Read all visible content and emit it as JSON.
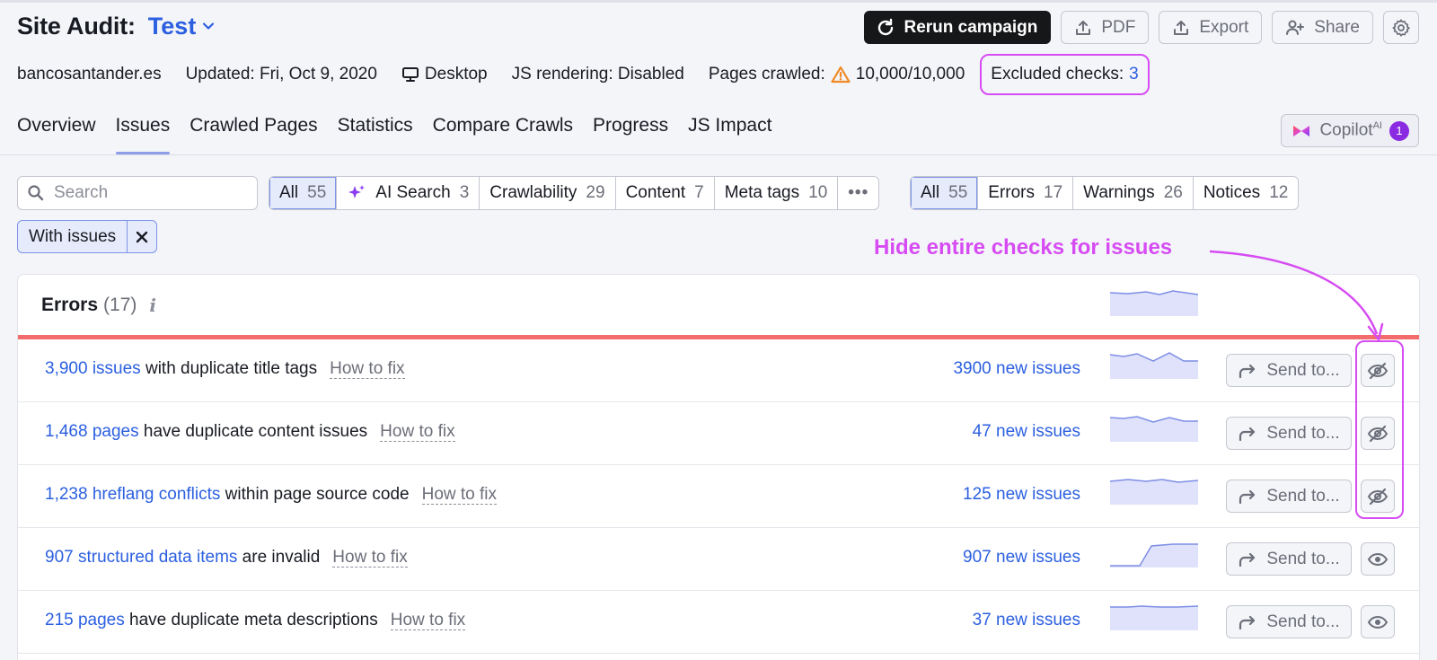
{
  "header": {
    "title": "Site Audit:",
    "project": "Test",
    "buttons": {
      "rerun": "Rerun campaign",
      "pdf": "PDF",
      "export": "Export",
      "share": "Share"
    },
    "meta": {
      "domain": "bancosantander.es",
      "updated": "Updated: Fri, Oct 9, 2020",
      "device": "Desktop",
      "js_rendering": "JS rendering: Disabled",
      "pages_crawled_label": "Pages crawled:",
      "pages_crawled_value": "10,000/10,000",
      "excluded_label": "Excluded checks:",
      "excluded_value": "3"
    }
  },
  "tabs": [
    {
      "label": "Overview"
    },
    {
      "label": "Issues"
    },
    {
      "label": "Crawled Pages"
    },
    {
      "label": "Statistics"
    },
    {
      "label": "Compare Crawls"
    },
    {
      "label": "Progress"
    },
    {
      "label": "JS Impact"
    }
  ],
  "active_tab": "Issues",
  "copilot": {
    "label": "Copilot",
    "sup": "AI",
    "badge": "1"
  },
  "search": {
    "placeholder": "Search"
  },
  "category_filters": [
    {
      "label": "All",
      "count": "55"
    },
    {
      "label": "AI Search",
      "count": "3"
    },
    {
      "label": "Crawlability",
      "count": "29"
    },
    {
      "label": "Content",
      "count": "7"
    },
    {
      "label": "Meta tags",
      "count": "10"
    },
    {
      "label": "•••"
    }
  ],
  "severity_filters": [
    {
      "label": "All",
      "count": "55"
    },
    {
      "label": "Errors",
      "count": "17"
    },
    {
      "label": "Warnings",
      "count": "26"
    },
    {
      "label": "Notices",
      "count": "12"
    }
  ],
  "chip": {
    "label": "With issues"
  },
  "annotation": "Hide entire checks for issues",
  "errors_panel": {
    "title": "Errors",
    "count": "(17)",
    "info": "i",
    "rows": [
      {
        "link": "3,900 issues",
        "text": " with duplicate title tags",
        "fix": "How to fix",
        "new": "3900 new issues",
        "send": "Send to...",
        "hidden": true
      },
      {
        "link": "1,468 pages",
        "text": " have duplicate content issues",
        "fix": "How to fix",
        "new": "47 new issues",
        "send": "Send to...",
        "hidden": true
      },
      {
        "link": "1,238 hreflang conflicts",
        "text": " within page source code",
        "fix": "How to fix",
        "new": "125 new issues",
        "send": "Send to...",
        "hidden": true
      },
      {
        "link": "907 structured data items",
        "text": " are invalid",
        "fix": "How to fix",
        "new": "907 new issues",
        "send": "Send to...",
        "hidden": false
      },
      {
        "link": "215 pages",
        "text": " have duplicate meta descriptions",
        "fix": "How to fix",
        "new": "37 new issues",
        "send": "Send to...",
        "hidden": false
      }
    ]
  },
  "colors": {
    "accent": "#2b5fe0",
    "annotation": "#d64cf2",
    "error_line": "#f36c6c",
    "sparkline_fill": "#dfe2fa"
  }
}
